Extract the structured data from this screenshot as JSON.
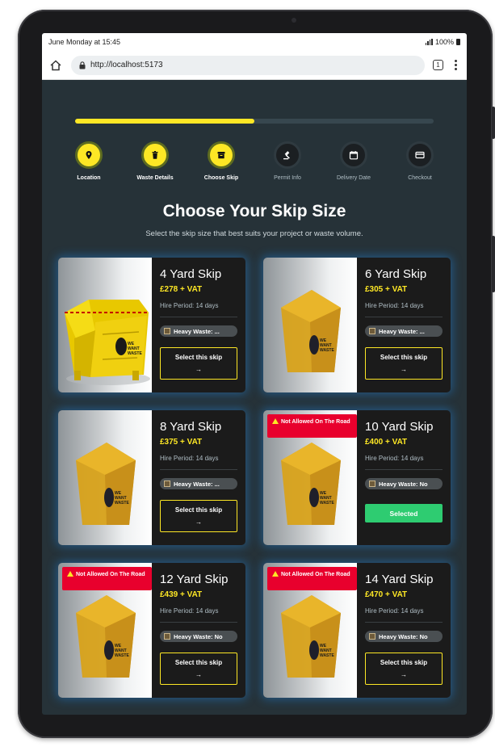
{
  "status": {
    "time": "June Monday at 15:45",
    "battery": "100%"
  },
  "browser": {
    "url": "http://localhost:5173",
    "tab_count": "1"
  },
  "progress": {
    "fraction": 0.5
  },
  "steps": [
    {
      "label": "Location",
      "state": "active",
      "icon": "location-pin-icon"
    },
    {
      "label": "Waste Details",
      "state": "active",
      "icon": "trash-icon"
    },
    {
      "label": "Choose Skip",
      "state": "active",
      "icon": "skip-box-icon"
    },
    {
      "label": "Permit Info",
      "state": "inactive",
      "icon": "gavel-icon"
    },
    {
      "label": "Delivery Date",
      "state": "inactive",
      "icon": "calendar-icon"
    },
    {
      "label": "Checkout",
      "state": "inactive",
      "icon": "credit-card-icon"
    }
  ],
  "heading": {
    "title": "Choose Your Skip Size",
    "subtitle": "Select the skip size that best suits your project or waste volume."
  },
  "skips": [
    {
      "name": "4 Yard Skip",
      "price": "£278 + VAT",
      "hire": "Hire Period: 14 days",
      "heavy": "Heavy Waste: ...",
      "button": "Select this skip",
      "arrow": "→",
      "warning": "",
      "selected": false
    },
    {
      "name": "6 Yard Skip",
      "price": "£305 + VAT",
      "hire": "Hire Period: 14 days",
      "heavy": "Heavy Waste: ...",
      "button": "Select this skip",
      "arrow": "→",
      "warning": "",
      "selected": false
    },
    {
      "name": "8 Yard Skip",
      "price": "£375 + VAT",
      "hire": "Hire Period: 14 days",
      "heavy": "Heavy Waste: ...",
      "button": "Select this skip",
      "arrow": "→",
      "warning": "",
      "selected": false
    },
    {
      "name": "10 Yard Skip",
      "price": "£400 + VAT",
      "hire": "Hire Period: 14 days",
      "heavy": "Heavy Waste: No",
      "button": "Selected",
      "arrow": "",
      "warning": "Not Allowed On The Road",
      "selected": true
    },
    {
      "name": "12 Yard Skip",
      "price": "£439 + VAT",
      "hire": "Hire Period: 14 days",
      "heavy": "Heavy Waste: No",
      "button": "Select this skip",
      "arrow": "→",
      "warning": "Not Allowed On The Road",
      "selected": false
    },
    {
      "name": "14 Yard Skip",
      "price": "£470 + VAT",
      "hire": "Hire Period: 14 days",
      "heavy": "Heavy Waste: No",
      "button": "Select this skip",
      "arrow": "→",
      "warning": "Not Allowed On The Road",
      "selected": false
    }
  ],
  "colors": {
    "accent": "#fde725",
    "selected": "#2ecc71",
    "warning": "#e8002d",
    "background": "#263238"
  }
}
